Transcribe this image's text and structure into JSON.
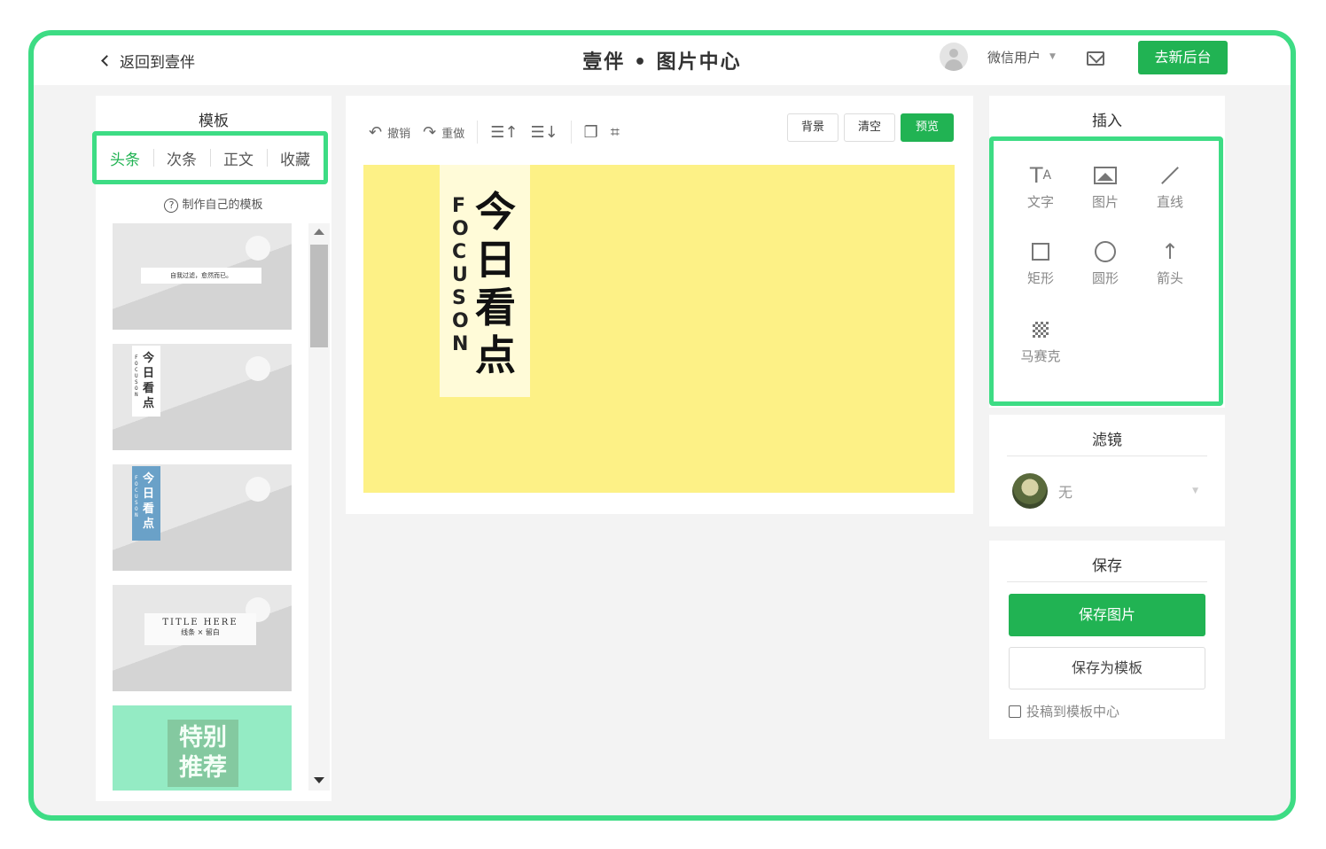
{
  "header": {
    "back_label": "返回到壹伴",
    "title": "壹伴 • 图片中心",
    "username": "微信用户",
    "admin_button": "去新后台"
  },
  "templates": {
    "title": "模板",
    "tabs": [
      "头条",
      "次条",
      "正文",
      "收藏"
    ],
    "active_tab": "头条",
    "make_own": "制作自己的模板",
    "thumbs": {
      "t1_text": "自我过滤，愈然而已。",
      "t2_focus": "FOCUS ON",
      "t2_cn": "今日看点",
      "t3_focus": "FOCUS ON",
      "t3_cn": "今日看点",
      "t4_title": "TITLE HERE",
      "t4_sub": "线条 × 留白",
      "t5_text": "特别推荐"
    }
  },
  "editor": {
    "undo": "撤销",
    "redo": "重做",
    "background": "背景",
    "clear": "清空",
    "preview": "预览",
    "canvas_focus": "FOCUS ON",
    "canvas_cn": "今日看点",
    "canvas_color": "#fdf186"
  },
  "insert": {
    "title": "插入",
    "tools": {
      "text": "文字",
      "image": "图片",
      "line": "直线",
      "rect": "矩形",
      "circle": "圆形",
      "arrow": "箭头",
      "mosaic": "马赛克"
    }
  },
  "filter": {
    "title": "滤镜",
    "selected": "无"
  },
  "save": {
    "title": "保存",
    "save_image": "保存图片",
    "save_template": "保存为模板",
    "submit_label": "投稿到模板中心"
  },
  "colors": {
    "accent": "#21b353",
    "highlight": "#3ddc84"
  }
}
